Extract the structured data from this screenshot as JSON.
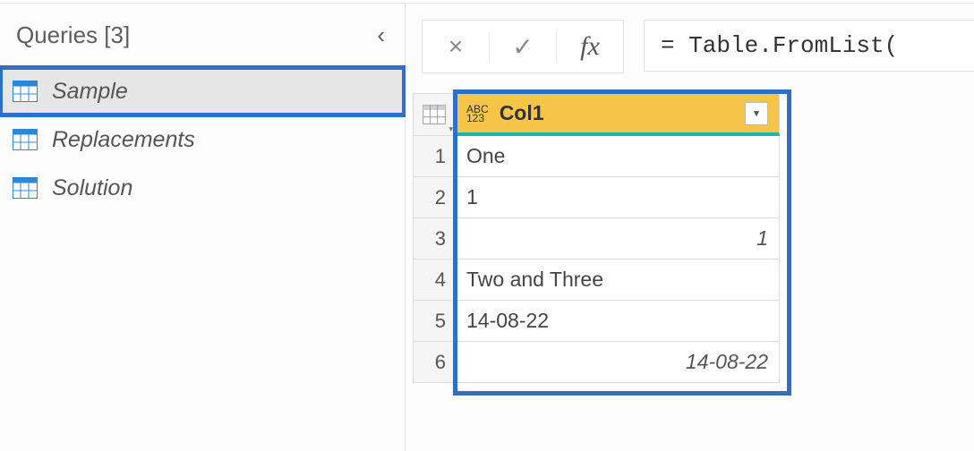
{
  "queries_pane": {
    "title": "Queries [3]",
    "items": [
      {
        "label": "Sample",
        "selected": true
      },
      {
        "label": "Replacements",
        "selected": false
      },
      {
        "label": "Solution",
        "selected": false
      }
    ]
  },
  "formula_bar": {
    "tools": {
      "cancel": "×",
      "confirm": "✓",
      "fx": "fx"
    },
    "formula": "= Table.FromList("
  },
  "data_table": {
    "column_type_label_top": "ABC",
    "column_type_label_bottom": "123",
    "column_header": "Col1",
    "rows": [
      {
        "n": "1",
        "value": "One",
        "align": "left"
      },
      {
        "n": "2",
        "value": "1",
        "align": "left"
      },
      {
        "n": "3",
        "value": "1",
        "align": "right"
      },
      {
        "n": "4",
        "value": "Two and Three",
        "align": "left"
      },
      {
        "n": "5",
        "value": "14-08-22",
        "align": "left"
      },
      {
        "n": "6",
        "value": "14-08-22",
        "align": "right"
      }
    ]
  }
}
